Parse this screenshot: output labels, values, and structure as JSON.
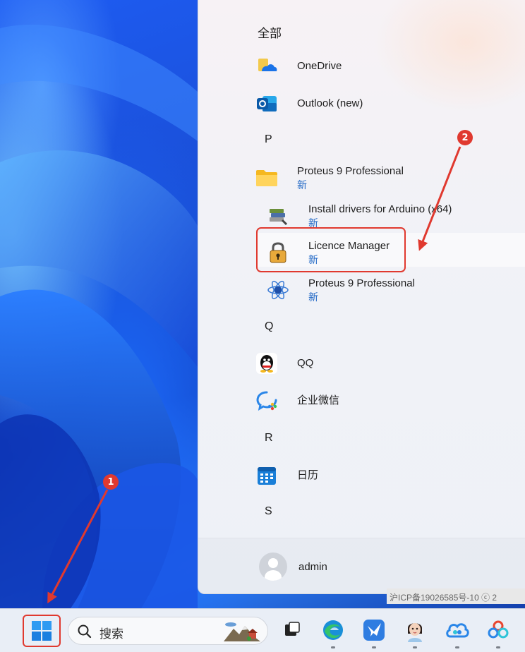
{
  "start_menu": {
    "section_title": "全部",
    "letters": {
      "p": "P",
      "q": "Q",
      "r": "R",
      "s": "S"
    },
    "apps": {
      "onedrive": {
        "name": "OneDrive"
      },
      "outlook": {
        "name": "Outlook (new)"
      },
      "proteus_folder": {
        "name": "Proteus 9 Professional",
        "badge": "新"
      },
      "install_drivers": {
        "name": "Install drivers for Arduino (x64)",
        "badge": "新"
      },
      "licence_manager": {
        "name": "Licence Manager",
        "badge": "新"
      },
      "proteus_app": {
        "name": "Proteus 9 Professional",
        "badge": "新"
      },
      "qq": {
        "name": "QQ"
      },
      "wecom": {
        "name": "企业微信"
      },
      "calendar": {
        "name": "日历"
      }
    },
    "user": {
      "name": "admin"
    }
  },
  "background_text": {
    "icp": "沪ICP备19026585号-10 ⓒ 2"
  },
  "taskbar": {
    "search_label": "搜索",
    "icons": [
      "start-icon",
      "search-icon",
      "task-view-icon",
      "edge-icon",
      "feishu-icon",
      "avatar-app-icon",
      "baidu-netdisk-icon",
      "app-icon"
    ]
  },
  "annotations": {
    "marker_1": "1",
    "marker_2": "2"
  },
  "colors": {
    "highlight": "#e0392f",
    "badge_new": "#1b64c4",
    "wallpaper_blue": "#1a4fd8"
  }
}
